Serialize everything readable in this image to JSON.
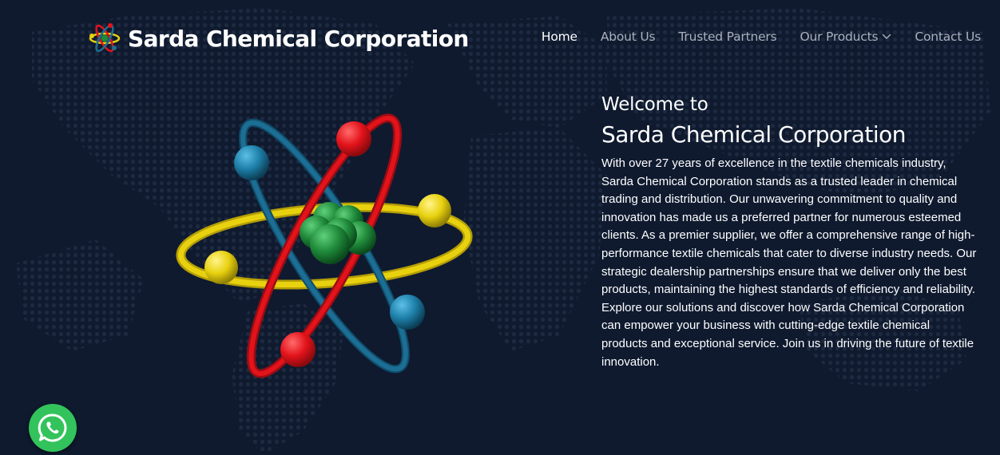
{
  "header": {
    "brand_name": "Sarda Chemical Corporation",
    "logo_icon": "atom-logo-icon"
  },
  "nav": {
    "items": [
      {
        "label": "Home",
        "active": true
      },
      {
        "label": "About Us",
        "active": false
      },
      {
        "label": "Trusted Partners",
        "active": false
      },
      {
        "label": "Our Products",
        "active": false,
        "has_dropdown": true
      },
      {
        "label": "Contact Us",
        "active": false
      }
    ]
  },
  "hero": {
    "welcome": "Welcome to",
    "company": "Sarda Chemical Corporation",
    "description": "With over 27 years of excellence in the textile chemicals industry, Sarda Chemical Corporation stands as a trusted leader in chemical trading and distribution. Our unwavering commitment to quality and innovation has made us a preferred partner for numerous esteemed clients. As a premier supplier, we offer a comprehensive range of high-performance textile chemicals that cater to diverse industry needs. Our strategic dealership partnerships ensure that we deliver only the best products, maintaining the highest standards of efficiency and reliability. Explore our solutions and discover how Sarda Chemical Corporation can empower your business with cutting-edge textile chemical products and exceptional service. Join us in driving the future of textile innovation.",
    "illustration_icon": "atom-illustration"
  },
  "floating": {
    "whatsapp_icon": "whatsapp-icon"
  },
  "colors": {
    "background": "#0f1a2f",
    "map_dots": "#1d2940",
    "text": "#ffffff",
    "nav_inactive": "#aab0bc",
    "whatsapp": "#33c35c",
    "atom_red": "#e3131b",
    "atom_blue": "#1d6e94",
    "atom_yellow": "#e8d10f",
    "atom_green": "#1f8a3a"
  }
}
